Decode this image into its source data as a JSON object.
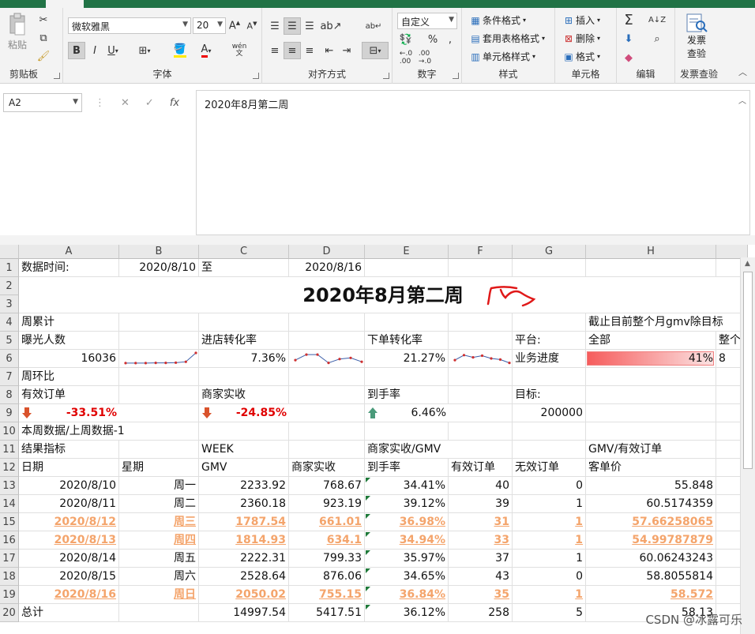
{
  "ribbon": {
    "clipboard": {
      "paste_label": "粘贴",
      "group_label": "剪贴板"
    },
    "font": {
      "font_name": "微软雅黑",
      "font_size": "20",
      "phonetic": "wén",
      "group_label": "字体"
    },
    "alignment": {
      "group_label": "对齐方式"
    },
    "number": {
      "format": "自定义",
      "group_label": "数字"
    },
    "styles": {
      "conditional": "条件格式",
      "table": "套用表格格式",
      "cell": "单元格样式",
      "group_label": "样式"
    },
    "cells": {
      "insert": "插入",
      "delete": "删除",
      "format": "格式",
      "group_label": "单元格"
    },
    "editing": {
      "group_label": "编辑"
    },
    "invoice": {
      "label_line1": "发票",
      "label_line2": "查验",
      "group_label": "发票查验"
    }
  },
  "formula_bar": {
    "name_box": "A2",
    "formula": "2020年8月第二周",
    "fx": "fx"
  },
  "columns": [
    "A",
    "B",
    "C",
    "D",
    "E",
    "F",
    "G",
    "H"
  ],
  "rows": [
    "1",
    "2",
    "3",
    "4",
    "5",
    "6",
    "7",
    "8",
    "9",
    "10",
    "11",
    "12",
    "13",
    "14",
    "15",
    "16",
    "17",
    "18",
    "19",
    "20"
  ],
  "sheet": {
    "r1": {
      "a": "数据时间:",
      "b": "2020/8/10",
      "c": "至",
      "d": "2020/8/16"
    },
    "title": "2020年8月第二周",
    "r4": {
      "a": "周累计",
      "h": "截止目前整个月gmv除目标"
    },
    "r5": {
      "a": "曝光人数",
      "c": "进店转化率",
      "e": "下单转化率",
      "g": "平台:",
      "h": "全部",
      "i": "整个"
    },
    "r6": {
      "a": "16036",
      "c": "7.36%",
      "e": "21.27%",
      "g": "业务进度",
      "h": "41%",
      "i": "8"
    },
    "r7": {
      "a": "周环比"
    },
    "r8": {
      "a": "有效订单",
      "c": "商家实收",
      "e": "到手率",
      "g": "目标:"
    },
    "r9": {
      "a": "-33.51%",
      "c": "-24.85%",
      "e": "6.46%",
      "g": "200000"
    },
    "r10": {
      "a": "本周数据/上周数据-1"
    },
    "r11": {
      "a": "结果指标",
      "c": "WEEK",
      "e": "商家实收/GMV",
      "h": "GMV/有效订单"
    },
    "r12": {
      "a": "日期",
      "b": "星期",
      "c": "GMV",
      "d": "商家实收",
      "e": "到手率",
      "f": "有效订单",
      "g": "无效订单",
      "h": "客单价"
    },
    "data": [
      [
        "2020/8/10",
        "周一",
        "2233.92",
        "768.67",
        "34.41%",
        "40",
        "0",
        "55.848"
      ],
      [
        "2020/8/11",
        "周二",
        "2360.18",
        "923.19",
        "39.12%",
        "39",
        "1",
        "60.5174359"
      ],
      [
        "2020/8/12",
        "周三",
        "1787.54",
        "661.01",
        "36.98%",
        "31",
        "1",
        "57.66258065"
      ],
      [
        "2020/8/13",
        "周四",
        "1814.93",
        "634.1",
        "34.94%",
        "33",
        "1",
        "54.99787879"
      ],
      [
        "2020/8/14",
        "周五",
        "2222.31",
        "799.33",
        "35.97%",
        "37",
        "1",
        "60.06243243"
      ],
      [
        "2020/8/15",
        "周六",
        "2528.64",
        "876.06",
        "34.65%",
        "43",
        "0",
        "58.8055814"
      ],
      [
        "2020/8/16",
        "周日",
        "2050.02",
        "755.15",
        "36.84%",
        "35",
        "1",
        "58.572"
      ]
    ],
    "highlighted_rows": [
      2,
      3,
      6
    ],
    "total": {
      "a": "总计",
      "c": "14997.54",
      "d": "5417.51",
      "e": "36.12%",
      "f": "258",
      "g": "5",
      "h": "58.13"
    },
    "progress_fraction": 0.41
  },
  "sparklines": {
    "exposure": [
      0.08,
      0.08,
      0.08,
      0.1,
      0.1,
      0.12,
      0.2,
      1.0
    ],
    "store_conv": [
      0.35,
      0.85,
      0.85,
      0.1,
      0.45,
      0.55,
      0.2
    ],
    "order_conv": [
      0.35,
      0.8,
      0.6,
      0.75,
      0.5,
      0.4,
      0.1
    ]
  },
  "colors": {
    "accent_green": "#217346",
    "highlight_orange": "#f4a46b",
    "negative_red": "#e00000",
    "up_arrow": "#4a9a7a",
    "down_arrow": "#d9532c"
  },
  "watermark": "CSDN @冰露可乐"
}
